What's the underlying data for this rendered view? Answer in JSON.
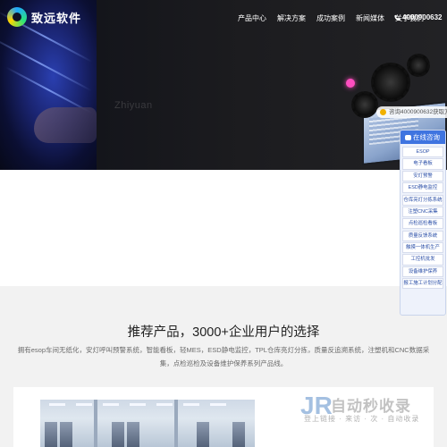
{
  "header": {
    "logo_text": "致远软件",
    "nav": [
      "产品中心",
      "解决方案",
      "成功案例",
      "新闻媒体",
      "关于我们"
    ],
    "phone": "4000900632"
  },
  "hero": {
    "subtitle": "Zhiyuan",
    "phone_tag": "咨询4000900632获取方案资料"
  },
  "side_panel": {
    "title": "在线咨询",
    "items": [
      "ESOP",
      "电子看板",
      "安灯预警",
      "ESD静电监控",
      "仓库亮灯分拣系统",
      "注塑CNC采集",
      "点检巡检看板",
      "质量反馈系统",
      "触摸一体机生产",
      "工控机批发",
      "设备维护保养",
      "报工施工计划分配"
    ]
  },
  "section": {
    "title": "推荐产品，3000+企业用户的选择",
    "desc": "拥有esop车间无纸化，安灯呼叫预警系统，智能看板，轻MES，ESD静电监控，TPL仓库亮灯分拣，质量反追溯系统，注塑机和CNC数据采集，点检巡检及设备维护保养系列产品线。"
  },
  "watermark": {
    "mark": "JR",
    "title": "自动秒收录",
    "subtitle": "登上链接 · 来访 · 次 · 自动收录"
  },
  "colors": {
    "accent": "#3f74e0",
    "hero_bg": "#1c1c1f"
  }
}
